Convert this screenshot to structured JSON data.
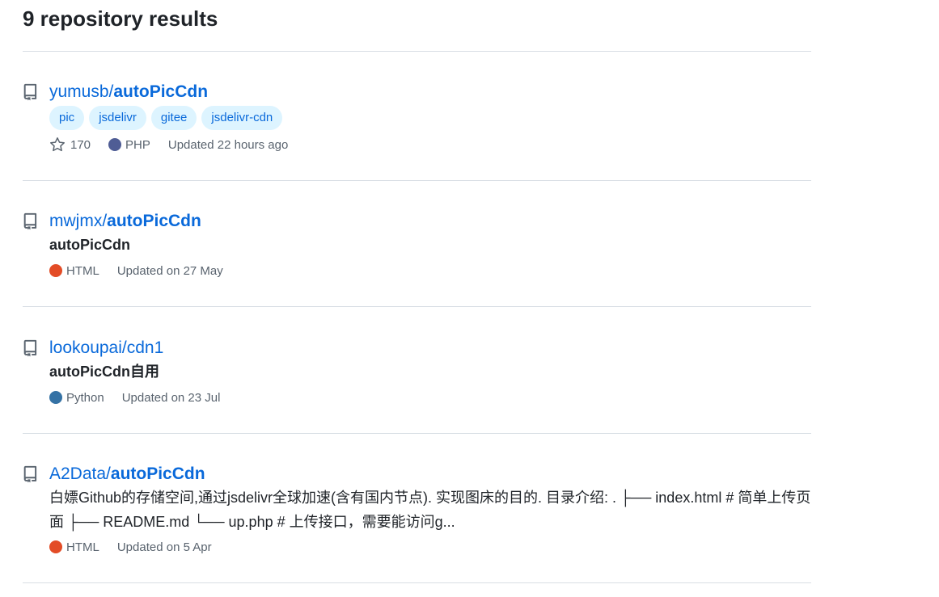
{
  "results_heading": "9 repository results",
  "repos": [
    {
      "owner": "yumusb/",
      "name": "autoPicCdn",
      "topics": [
        "pic",
        "jsdelivr",
        "gitee",
        "jsdelivr-cdn"
      ],
      "stars": "170",
      "language": "PHP",
      "language_color": "#4F5D95",
      "updated": "Updated 22 hours ago"
    },
    {
      "owner": "mwjmx/",
      "name": "autoPicCdn",
      "description": "autoPicCdn",
      "language": "HTML",
      "language_color": "#e34c26",
      "updated": "Updated on 27 May"
    },
    {
      "owner": "lookoupai/",
      "name": "cdn1",
      "description": "autoPicCdn自用",
      "language": "Python",
      "language_color": "#3572A5",
      "updated": "Updated on 23 Jul"
    },
    {
      "owner": "A2Data/",
      "name": "autoPicCdn",
      "description": "白嫖Github的存储空间,通过jsdelivr全球加速(含有国内节点). 实现图床的目的. 目录介绍: . ├── index.html # 简单上传页面 ├── README.md └── up.php # 上传接口，需要能访问g...",
      "language": "HTML",
      "language_color": "#e34c26",
      "updated": "Updated on 5 Apr"
    }
  ]
}
